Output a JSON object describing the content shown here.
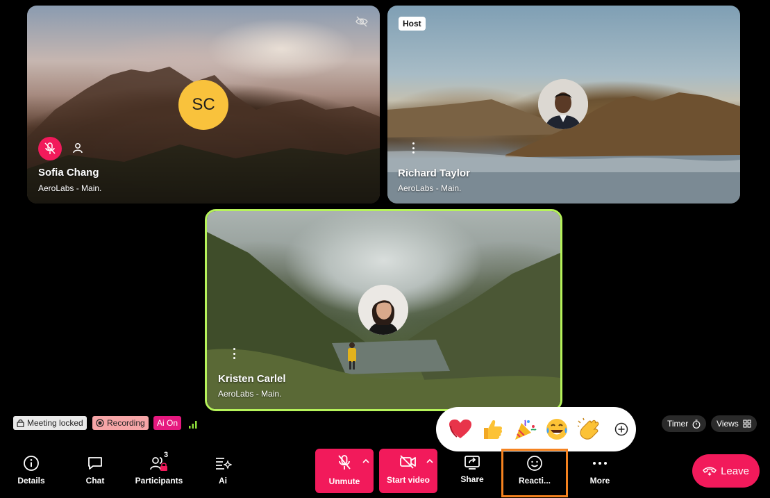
{
  "participants": [
    {
      "name": "Sofia Chang",
      "org": "AeroLabs - Main.",
      "initials": "SC"
    },
    {
      "name": "Richard Taylor",
      "org": "AeroLabs - Main.",
      "badge": "Host"
    },
    {
      "name": "Kristen Carlel",
      "org": "AeroLabs - Main."
    }
  ],
  "status": {
    "meeting_locked": "Meeting locked",
    "recording": "Recording",
    "ai": "Ai On"
  },
  "toolbar": {
    "details": "Details",
    "chat": "Chat",
    "participants": "Participants",
    "participants_count": "3",
    "ai": "Ai",
    "unmute": "Unmute",
    "start_video": "Start video",
    "share": "Share",
    "reactions": "Reacti...",
    "more": "More",
    "leave": "Leave"
  },
  "right_controls": {
    "timer": "Timer",
    "views": "Views"
  },
  "reactions": [
    "heart",
    "thumbs-up",
    "party-popper",
    "tears-of-joy",
    "clapping-hands",
    "add-reaction"
  ],
  "colors": {
    "accent_red": "#f21a5b",
    "active_speaker": "#b6f35a",
    "selected_outline": "#f5821f",
    "avatar_yellow": "#f9c23c"
  }
}
